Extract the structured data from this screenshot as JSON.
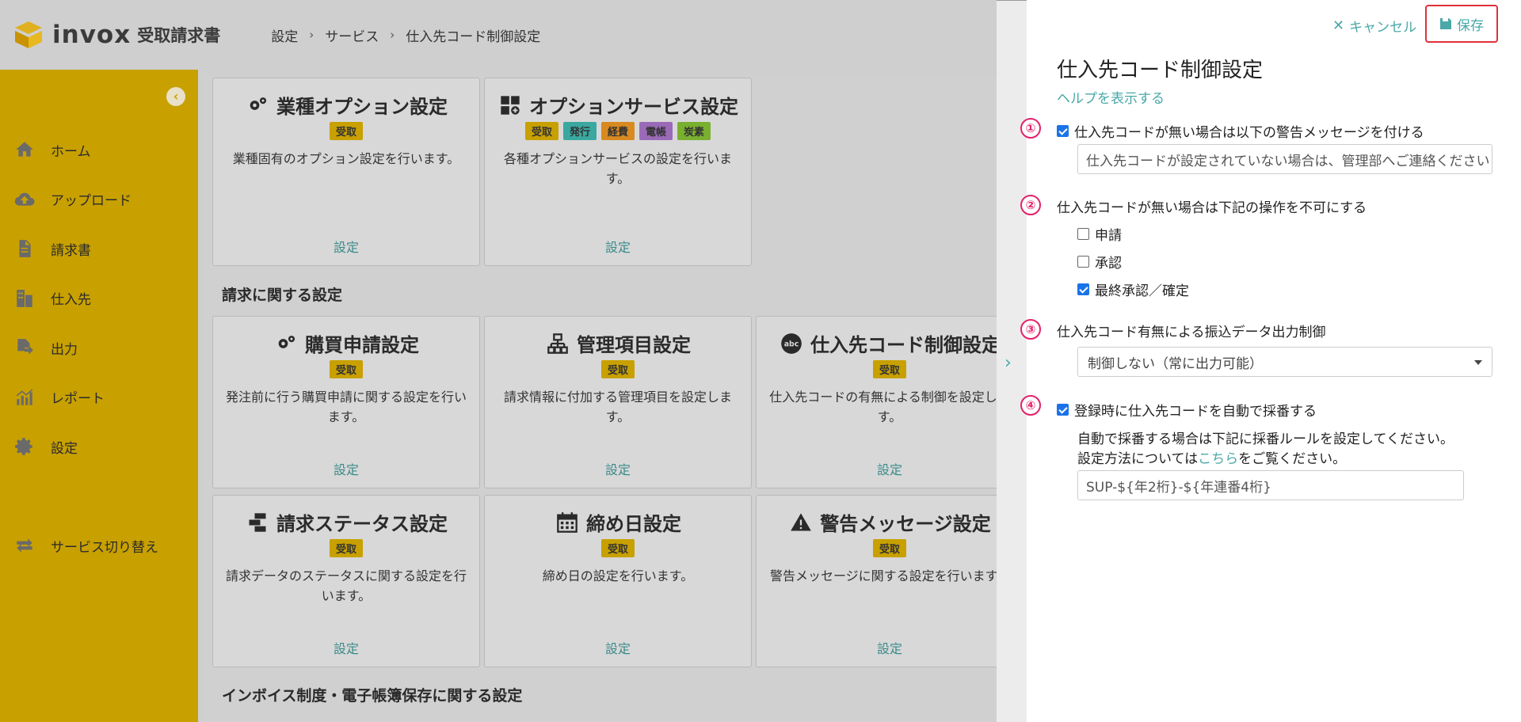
{
  "header": {
    "logo_text": "invox",
    "logo_sub": "受取請求書",
    "breadcrumb": [
      "設定",
      "サービス",
      "仕入先コード制御設定"
    ]
  },
  "sidebar": {
    "items": [
      {
        "label": "ホーム",
        "icon": "home-icon"
      },
      {
        "label": "アップロード",
        "icon": "cloud-upload-icon"
      },
      {
        "label": "請求書",
        "icon": "document-icon"
      },
      {
        "label": "仕入先",
        "icon": "building-icon"
      },
      {
        "label": "出力",
        "icon": "export-file-icon"
      },
      {
        "label": "レポート",
        "icon": "chart-icon"
      },
      {
        "label": "設定",
        "icon": "gear-icon"
      }
    ],
    "switch_label": "サービス切り替え"
  },
  "main": {
    "cards": [
      {
        "title": "業種オプション設定",
        "badges": [
          "受取"
        ],
        "desc": "業種固有のオプション設定を行います。",
        "link": "設定"
      },
      {
        "title": "オプションサービス設定",
        "badges": [
          "受取",
          "発行",
          "経費",
          "電帳",
          "炭素"
        ],
        "desc": "各種オプションサービスの設定を行います。",
        "link": "設定"
      },
      {
        "title": "購買申請設定",
        "badges": [
          "受取"
        ],
        "desc": "発注前に行う購買申請に関する設定を行います。",
        "link": "設定"
      },
      {
        "title": "管理項目設定",
        "badges": [
          "受取"
        ],
        "desc": "請求情報に付加する管理項目を設定します。",
        "link": "設定"
      },
      {
        "title": "仕入先コード制御設定",
        "badges": [
          "受取"
        ],
        "desc": "仕入先コードの有無による制御を設定します。",
        "link": "設定"
      },
      {
        "title": "請求ステータス設定",
        "badges": [
          "受取"
        ],
        "desc": "請求データのステータスに関する設定を行います。",
        "link": "設定"
      },
      {
        "title": "締め日設定",
        "badges": [
          "受取"
        ],
        "desc": "締め日の設定を行います。",
        "link": "設定"
      },
      {
        "title": "警告メッセージ設定",
        "badges": [
          "受取"
        ],
        "desc": "警告メッセージに関する設定を行います。",
        "link": "設定"
      }
    ],
    "section_billing": "請求に関する設定",
    "section_invoice": "インボイス制度・電子帳簿保存に関する設定"
  },
  "badge_colors": {
    "受取": "#c8a000",
    "発行": "#3aa8a0",
    "経費": "#d88a20",
    "電帳": "#9a6ab8",
    "炭素": "#7ab030"
  },
  "panel": {
    "cancel_label": "キャンセル",
    "save_label": "保存",
    "title": "仕入先コード制御設定",
    "help_link": "ヘルプを表示する",
    "num1": "①",
    "num2": "②",
    "num3": "③",
    "num4": "④",
    "opt1_label": "仕入先コードが無い場合は以下の警告メッセージを付ける",
    "opt1_checked": true,
    "opt1_input_value": "仕入先コードが設定されていない場合は、管理部へご連絡ください",
    "opt2_label": "仕入先コードが無い場合は下記の操作を不可にする",
    "opt2_items": [
      {
        "label": "申請",
        "checked": false
      },
      {
        "label": "承認",
        "checked": false
      },
      {
        "label": "最終承認／確定",
        "checked": true
      }
    ],
    "opt3_label": "仕入先コード有無による振込データ出力制御",
    "opt3_selected": "制御しない（常に出力可能）",
    "opt4_label": "登録時に仕入先コードを自動で採番する",
    "opt4_checked": true,
    "opt4_note1": "自動で採番する場合は下記に採番ルールを設定してください。",
    "opt4_note2_prefix": "設定方法については",
    "opt4_note2_link": "こちら",
    "opt4_note2_suffix": "をご覧ください。",
    "opt4_input_value": "SUP-${年2桁}-${年連番4桁}"
  }
}
